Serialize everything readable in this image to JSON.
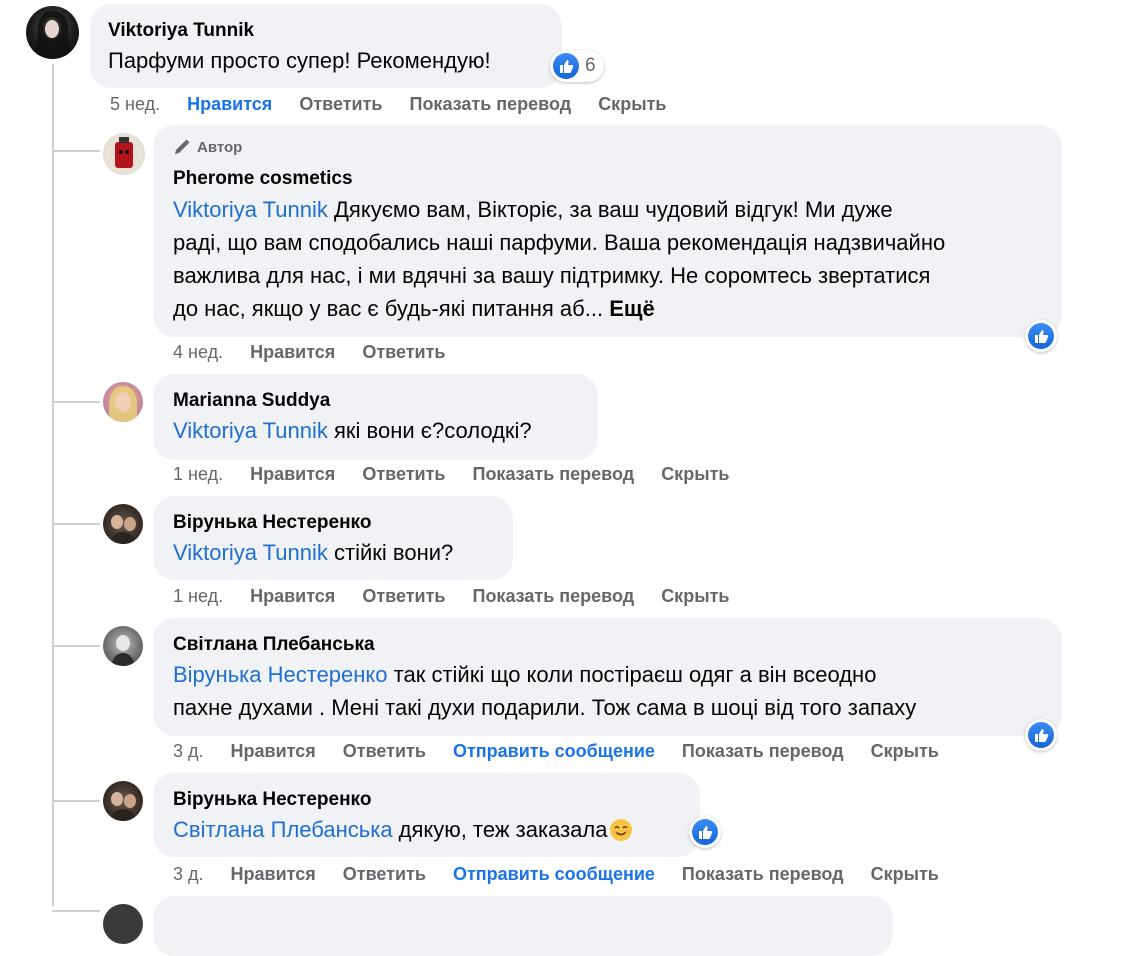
{
  "comments": [
    {
      "author": "Viktoriya Tunnik",
      "text": "Парфуми просто супер! Рекомендую!",
      "reaction_count": "6",
      "time": "5 нед.",
      "actions": [
        "Нравится",
        "Ответить",
        "Показать перевод",
        "Скрыть"
      ]
    },
    {
      "badge": "Автор",
      "author": "Pherome cosmetics",
      "mention": "Viktoriya Tunnik",
      "lines": [
        " Дякуємо вам, Вікторіє, за ваш чудовий відгук! Ми дуже",
        "раді, що вам сподобались наші парфуми. Ваша рекомендація надзвичайно",
        "важлива для нас, і ми вдячні за вашу підтримку. Не соромтесь звертатися",
        "до нас, якщо у вас є будь-які питання аб... "
      ],
      "more": "Ещё",
      "time": "4 нед.",
      "actions": [
        "Нравится",
        "Ответить"
      ]
    },
    {
      "author": "Marianna Suddya",
      "mention": "Viktoriya Tunnik",
      "text": " які вони є?солодкі?",
      "time": "1 нед.",
      "actions": [
        "Нравится",
        "Ответить",
        "Показать перевод",
        "Скрыть"
      ]
    },
    {
      "author": "Вірунька Нестеренко",
      "mention": "Viktoriya Tunnik",
      "text": " стійкі вони?",
      "time": "1 нед.",
      "actions": [
        "Нравится",
        "Ответить",
        "Показать перевод",
        "Скрыть"
      ]
    },
    {
      "author": "Світлана Плебанська",
      "mention": "Вірунька Нестеренко",
      "lines": [
        " так стійкі що коли постіраєш одяг а він всеодно",
        "пахне духами . Мені такі духи подарили. Тож сама в шоці від того запаху"
      ],
      "time": "3 д.",
      "actions": [
        "Нравится",
        "Ответить",
        "Отправить сообщение",
        "Показать перевод",
        "Скрыть"
      ]
    },
    {
      "author": "Вірунька Нестеренко",
      "mention": "Світлана Плебанська",
      "text": " дякую, теж заказала",
      "time": "3 д.",
      "actions": [
        "Нравится",
        "Ответить",
        "Отправить сообщение",
        "Показать перевод",
        "Скрыть"
      ]
    }
  ],
  "colors": {
    "mention": "#1f6fd1",
    "liked": "#1a73e8",
    "bubble": "#f0f2f5",
    "meta": "#65676b"
  },
  "icons": [
    "like-icon",
    "pencil-icon",
    "smile-emoji-icon"
  ]
}
